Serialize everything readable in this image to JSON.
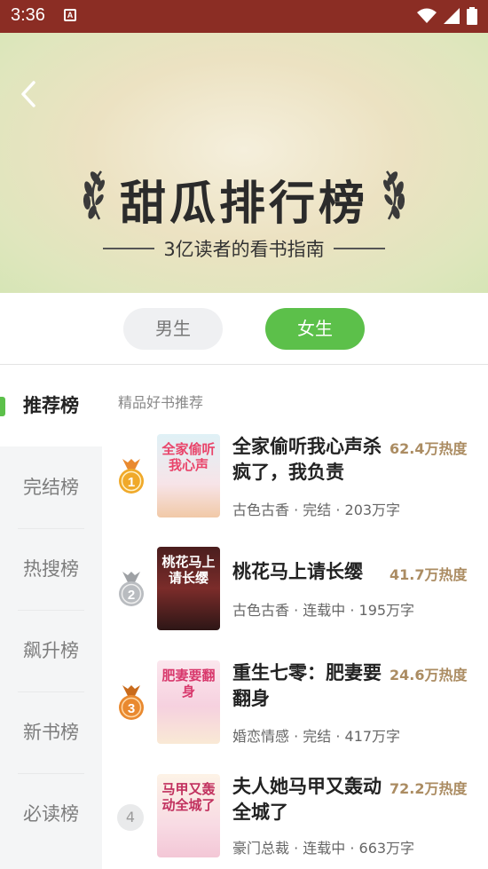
{
  "status_bar": {
    "time": "3:36",
    "notification_icon": "A"
  },
  "banner": {
    "title": "甜瓜排行榜",
    "subtitle": "3亿读者的看书指南"
  },
  "gender_tabs": [
    {
      "label": "男生"
    },
    {
      "label": "女生"
    }
  ],
  "sidebar": {
    "items": [
      {
        "label": "推荐榜"
      },
      {
        "label": "完结榜"
      },
      {
        "label": "热搜榜"
      },
      {
        "label": "飙升榜"
      },
      {
        "label": "新书榜"
      },
      {
        "label": "必读榜"
      }
    ]
  },
  "section_label": "精品好书推荐",
  "books": [
    {
      "rank": "1",
      "title": "全家偷听我心声杀疯了，我负责",
      "heat": "62.4万热度",
      "meta": "古色古香 · 完结 · 203万字",
      "cover_text": "全家偷听我心声",
      "medal_color": "#f0a92a"
    },
    {
      "rank": "2",
      "title": "桃花马上请长缨",
      "heat": "41.7万热度",
      "meta": "古色古香 · 连载中 · 195万字",
      "cover_text": "桃花马上请长缨",
      "medal_color": "#b9bcc0"
    },
    {
      "rank": "3",
      "title": "重生七零：肥妻要翻身",
      "heat": "24.6万热度",
      "meta": "婚恋情感 · 完结 · 417万字",
      "cover_text": "肥妻要翻身",
      "medal_color": "#e9892f"
    },
    {
      "rank": "4",
      "title": "夫人她马甲又轰动全城了",
      "heat": "72.2万热度",
      "meta": "豪门总裁 · 连载中 · 663万字",
      "cover_text": "马甲又轰动全城了"
    }
  ],
  "colors": {
    "accent": "#5cc04a",
    "heat": "#ab8c62",
    "status_bar": "#8b2d24"
  }
}
